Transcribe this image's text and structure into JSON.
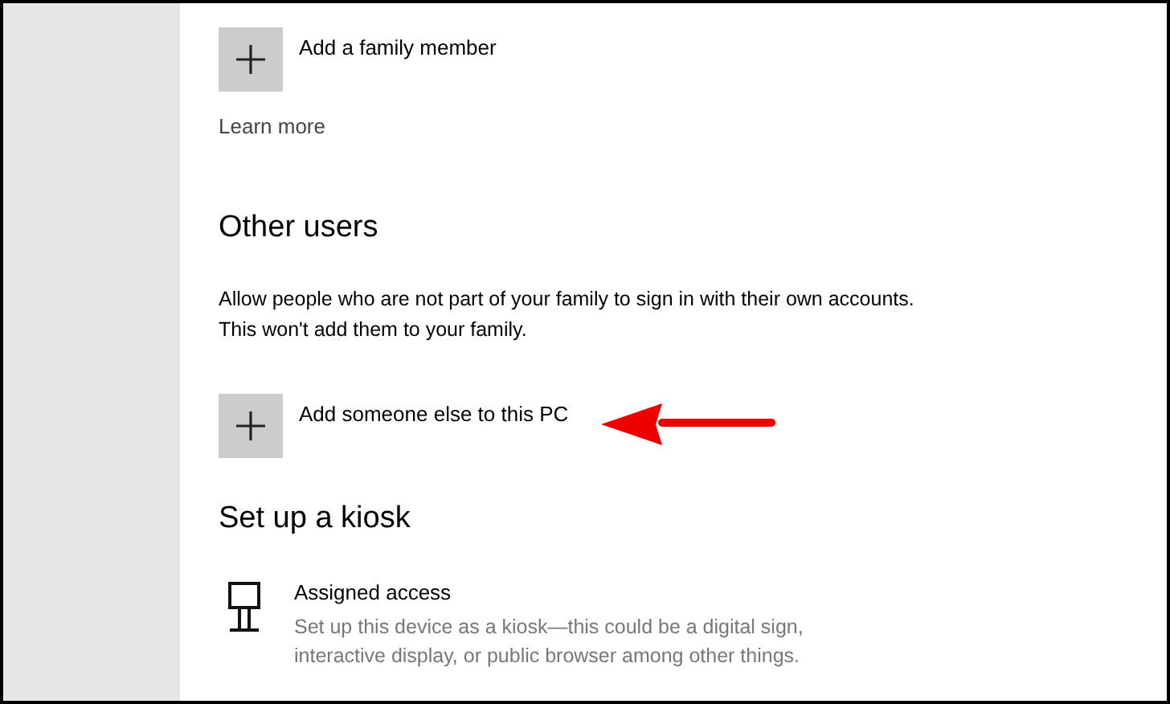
{
  "family": {
    "add_label": "Add a family member",
    "link": "Learn more"
  },
  "other_users": {
    "heading": "Other users",
    "description": "Allow people who are not part of your family to sign in with their own accounts. This won't add them to your family.",
    "add_label": "Add someone else to this PC"
  },
  "kiosk": {
    "heading": "Set up a kiosk",
    "title": "Assigned access",
    "description": "Set up this device as a kiosk—this could be a digital sign, interactive display, or public browser among other things."
  }
}
